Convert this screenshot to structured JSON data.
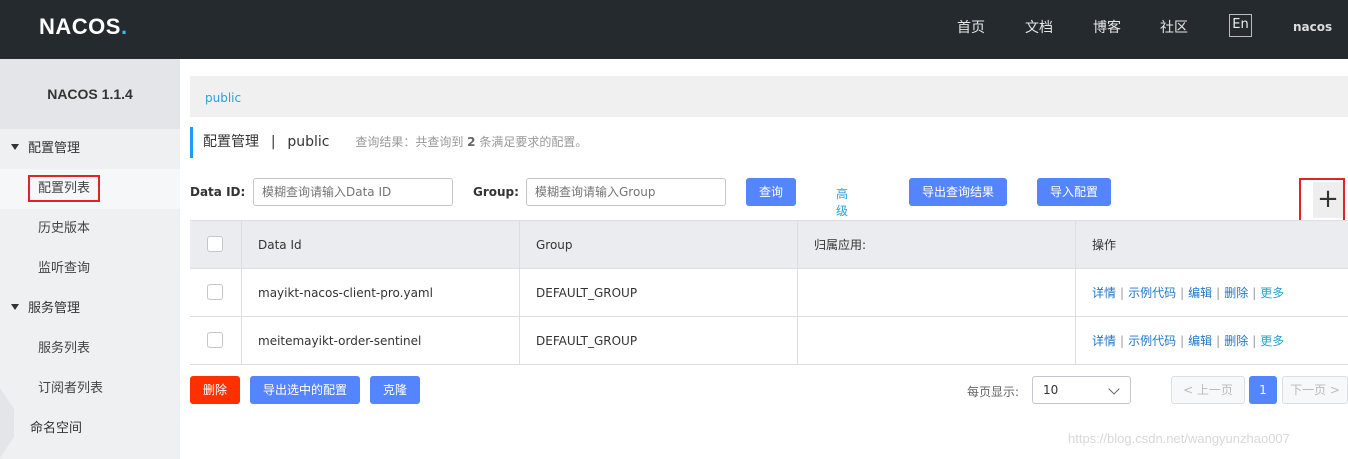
{
  "header": {
    "logo_text": "NACOS",
    "logo_dot": ".",
    "nav": [
      "首页",
      "文档",
      "博客",
      "社区"
    ],
    "lang": "En",
    "user": "nacos"
  },
  "sidebar": {
    "version": "NACOS 1.1.4",
    "config_group": "配置管理",
    "config_items": [
      "配置列表",
      "历史版本",
      "监听查询"
    ],
    "service_group": "服务管理",
    "service_items": [
      "服务列表",
      "订阅者列表"
    ],
    "namespace": "命名空间"
  },
  "breadcrumb": "public",
  "title": {
    "main": "配置管理",
    "sep": "|",
    "namespace": "public",
    "query_prefix": "查询结果：共查询到",
    "query_count": "2",
    "query_suffix": "条满足要求的配置。"
  },
  "filters": {
    "dataid_label": "Data ID:",
    "dataid_placeholder": "模糊查询请输入Data ID",
    "group_label": "Group:",
    "group_placeholder": "模糊查询请输入Group",
    "query_button": "查询",
    "advanced_link": "高级查询",
    "export_query_button": "导出查询结果",
    "import_button": "导入配置",
    "add_symbol": "+"
  },
  "table": {
    "headers": [
      "Data Id",
      "Group",
      "归属应用:",
      "操作"
    ],
    "rows": [
      {
        "data_id": "mayikt-nacos-client-pro.yaml",
        "group": "DEFAULT_GROUP",
        "app": ""
      },
      {
        "data_id": "meitemayikt-order-sentinel",
        "group": "DEFAULT_GROUP",
        "app": ""
      }
    ],
    "ops": {
      "detail": "详情",
      "sample": "示例代码",
      "edit": "编辑",
      "delete": "删除",
      "more": "更多",
      "sep": "|"
    }
  },
  "footer": {
    "delete_button": "删除",
    "export_selected_button": "导出选中的配置",
    "clone_button": "克隆",
    "page_size_label": "每页显示:",
    "page_size_value": "10",
    "prev": "< 上一页",
    "current_page": "1",
    "next": "下一页 >"
  },
  "watermark": "https://blog.csdn.net/wangyunzhao007",
  "colors": {
    "header_bg": "#252a2f",
    "primary": "#5584ff",
    "danger": "#ff3000",
    "link": "#2ba0d9",
    "highlight_border": "#e0222a"
  }
}
